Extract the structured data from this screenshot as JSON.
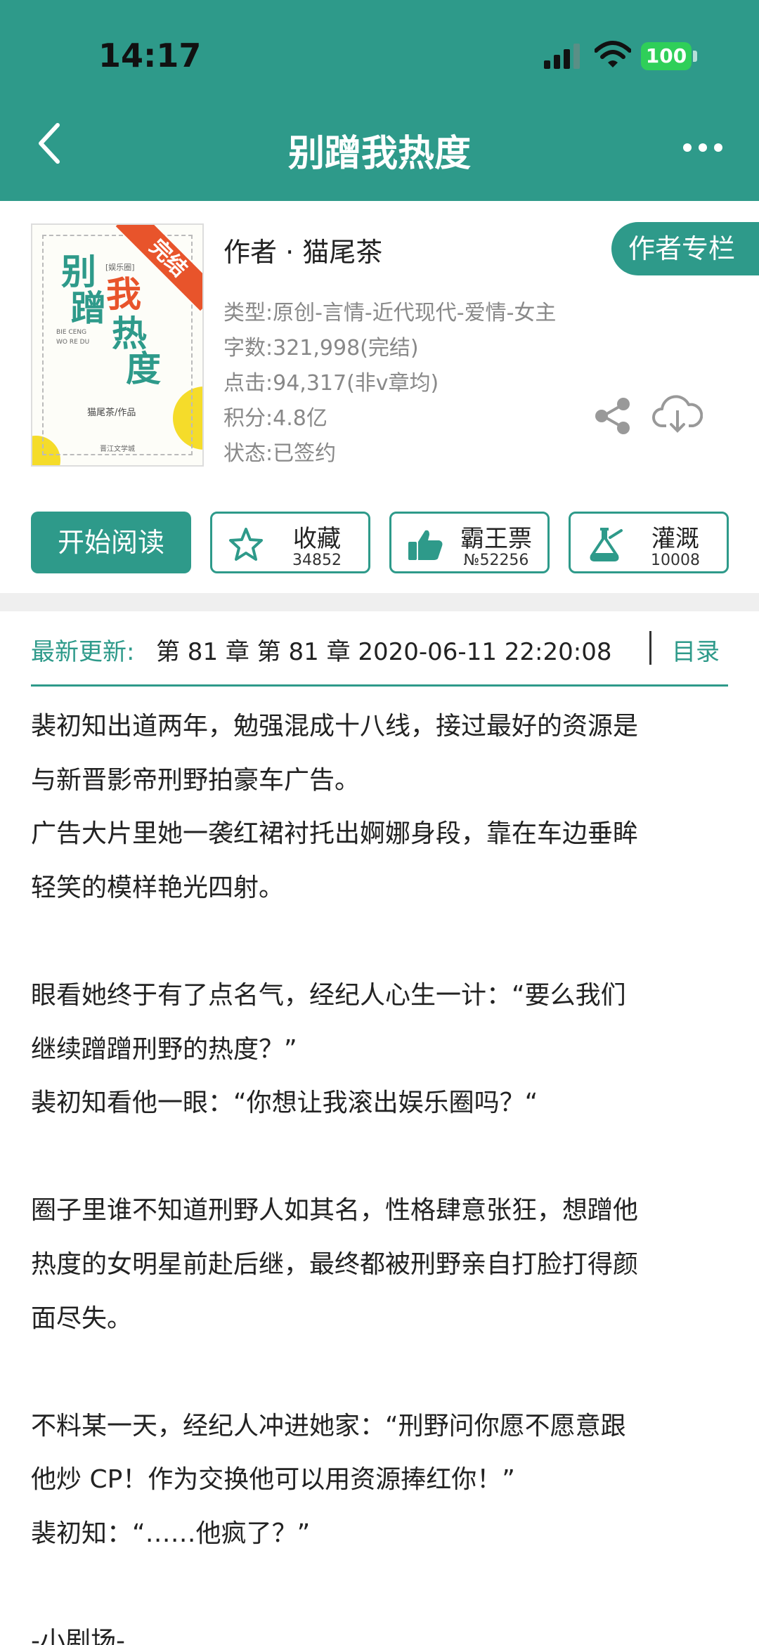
{
  "status_bar": {
    "time": "14:17",
    "battery": "100"
  },
  "nav": {
    "title": "别蹭我热度"
  },
  "book": {
    "cover": {
      "title_chars": [
        "别",
        "蹭",
        "我",
        "热",
        "度"
      ],
      "ribbon": "完结",
      "genre_tag": "[娱乐圈]",
      "pinyin_1": "BIE CENG",
      "pinyin_2": "WO RE DU",
      "author_credit": "猫尾茶/作品",
      "publisher": "晋江文学城"
    },
    "author": "作者 · 猫尾茶",
    "author_column_button": "作者专栏",
    "meta": [
      "类型:原创-言情-近代现代-爱情-女主",
      "字数:321,998(完结)",
      "点击:94,317(非v章均)",
      "积分:4.8亿",
      "状态:已签约"
    ]
  },
  "actions": {
    "read": "开始阅读",
    "collect": {
      "label": "收藏",
      "count": "34852"
    },
    "vote": {
      "label": "霸王票",
      "count": "№52256"
    },
    "water": {
      "label": "灌溉",
      "count": "10008"
    }
  },
  "update": {
    "label": "最新更新:",
    "text": "第 81 章 第 81 章 2020-06-11 22:20:08",
    "toc": "目录"
  },
  "intro_lines": [
    "裴初知出道两年，勉强混成十八线，接过最好的资源是",
    "与新晋影帝刑野拍豪车广告。",
    "广告大片里她一袭红裙衬托出婀娜身段，靠在车边垂眸",
    "轻笑的模样艳光四射。",
    "",
    "眼看她终于有了点名气，经纪人心生一计：“要么我们",
    "继续蹭蹭刑野的热度？”",
    "裴初知看他一眼：“你想让我滚出娱乐圈吗？“",
    "",
    "圈子里谁不知道刑野人如其名，性格肆意张狂，想蹭他",
    "热度的女明星前赴后继，最终都被刑野亲自打脸打得颜",
    "面尽失。",
    "",
    "不料某一天，经纪人冲进她家：“刑野问你愿不愿意跟",
    "他炒 CP！作为交换他可以用资源捧红你！”",
    "裴初知：“……他疯了？”",
    "",
    "-小剧场-"
  ],
  "colors": {
    "accent": "#2e9a8a",
    "ribbon": "#e8542b"
  }
}
